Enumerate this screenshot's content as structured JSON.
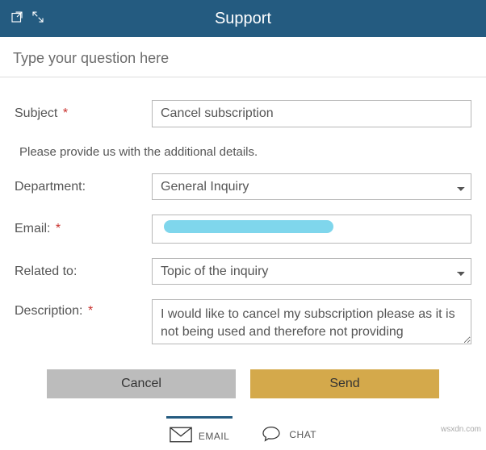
{
  "header": {
    "title": "Support"
  },
  "search": {
    "placeholder": "Type your question here"
  },
  "form": {
    "subject": {
      "label": "Subject",
      "required": "*",
      "value": "Cancel subscription"
    },
    "helper": "Please provide us with the additional details.",
    "department": {
      "label": "Department:",
      "value": "General Inquiry"
    },
    "email": {
      "label": "Email:",
      "required": "*",
      "value": ""
    },
    "related": {
      "label": "Related to:",
      "value": "Topic of the inquiry"
    },
    "description": {
      "label": "Description:",
      "required": "*",
      "value": "I would like to cancel my subscription please as it is not being used and therefore not providing"
    }
  },
  "buttons": {
    "cancel": "Cancel",
    "send": "Send"
  },
  "tabs": {
    "email": "EMAIL",
    "chat": "CHAT"
  },
  "watermark": "wsxdn.com"
}
